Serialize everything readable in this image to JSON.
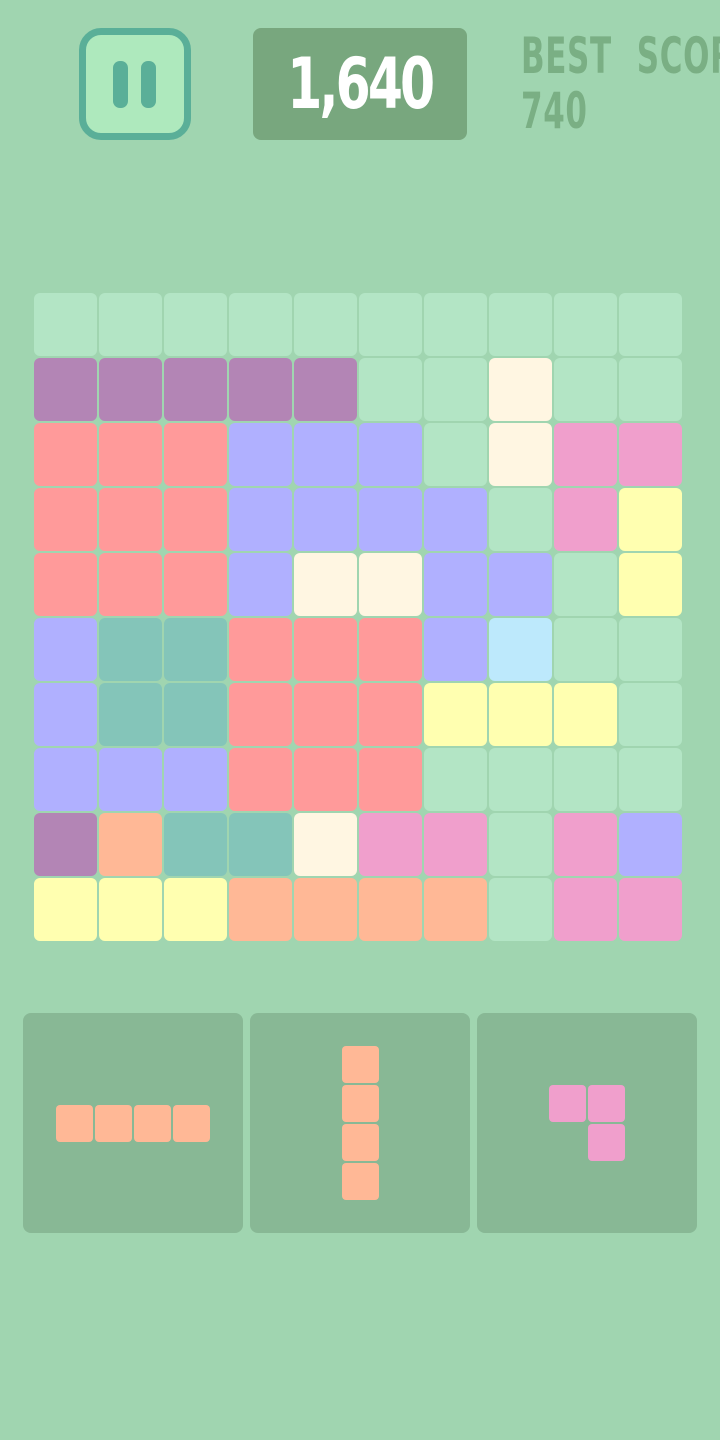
{
  "header": {
    "pause_icon": "pause-icon",
    "score": "1,640",
    "best_label": "BEST SCORE",
    "best_value": "740"
  },
  "colors": {
    "background": "#a0d5b0",
    "empty": "#b3e5c5",
    "purple": "#b385b5",
    "red": "#ff9a9a",
    "blue": "#b0b0ff",
    "cream": "#fff6e2",
    "pink": "#f09fcc",
    "yellow": "#ffffb0",
    "teal": "#84c5b9",
    "lightblue": "#bde9fc",
    "orange": "#ffb896",
    "score_box": "#78a77e",
    "tray": "#88b895"
  },
  "board": {
    "rows": 10,
    "cols": 10,
    "cells": [
      [
        "empty",
        "empty",
        "empty",
        "empty",
        "empty",
        "empty",
        "empty",
        "empty",
        "empty",
        "empty"
      ],
      [
        "purple",
        "purple",
        "purple",
        "purple",
        "purple",
        "empty",
        "empty",
        "cream",
        "empty",
        "empty"
      ],
      [
        "red",
        "red",
        "red",
        "blue",
        "blue",
        "blue",
        "empty",
        "cream",
        "pink",
        "pink"
      ],
      [
        "red",
        "red",
        "red",
        "blue",
        "blue",
        "blue",
        "blue",
        "empty",
        "pink",
        "yellow"
      ],
      [
        "red",
        "red",
        "red",
        "blue",
        "cream",
        "cream",
        "blue",
        "blue",
        "empty",
        "yellow"
      ],
      [
        "blue",
        "teal",
        "teal",
        "red",
        "red",
        "red",
        "blue",
        "lightblue",
        "empty",
        "empty"
      ],
      [
        "blue",
        "teal",
        "teal",
        "red",
        "red",
        "red",
        "yellow",
        "yellow",
        "yellow",
        "empty"
      ],
      [
        "blue",
        "blue",
        "blue",
        "red",
        "red",
        "red",
        "empty",
        "empty",
        "empty",
        "empty"
      ],
      [
        "purple",
        "orange",
        "teal",
        "teal",
        "cream",
        "pink",
        "pink",
        "empty",
        "pink",
        "blue"
      ],
      [
        "yellow",
        "yellow",
        "yellow",
        "orange",
        "orange",
        "orange",
        "orange",
        "empty",
        "pink",
        "pink"
      ]
    ]
  },
  "pieces": [
    {
      "name": "horizontal-i-piece",
      "color": "orange",
      "rows": 1,
      "cols": 4,
      "cells": [
        [
          0,
          0
        ],
        [
          0,
          1
        ],
        [
          0,
          2
        ],
        [
          0,
          3
        ]
      ]
    },
    {
      "name": "vertical-i-piece",
      "color": "orange",
      "rows": 4,
      "cols": 1,
      "cells": [
        [
          0,
          0
        ],
        [
          1,
          0
        ],
        [
          2,
          0
        ],
        [
          3,
          0
        ]
      ]
    },
    {
      "name": "corner-piece",
      "color": "pink",
      "rows": 2,
      "cols": 2,
      "cells": [
        [
          0,
          0
        ],
        [
          0,
          1
        ],
        [
          1,
          1
        ]
      ]
    }
  ]
}
